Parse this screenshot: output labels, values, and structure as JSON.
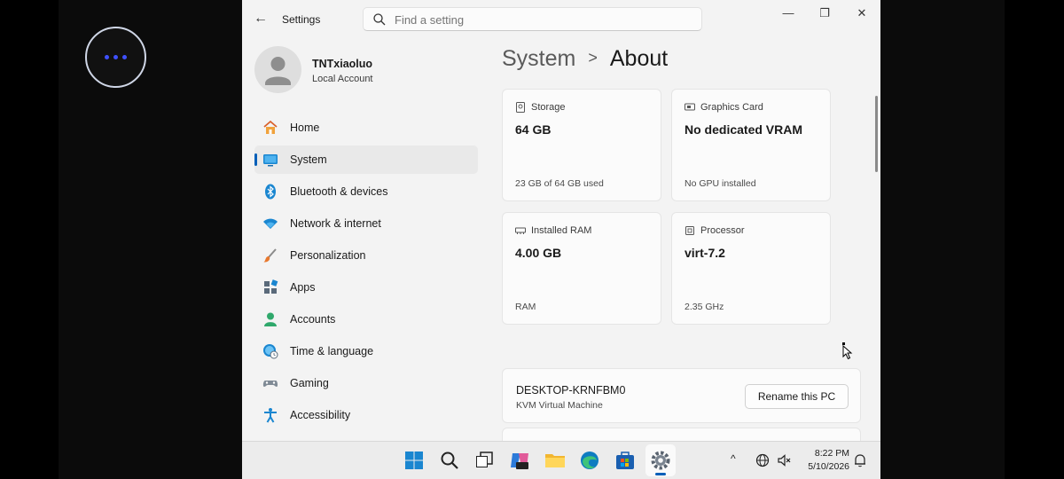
{
  "window": {
    "title": "Settings",
    "search_placeholder": "Find a setting",
    "controls": {
      "minimize": "—",
      "maximize": "❐",
      "close": "✕"
    }
  },
  "profile": {
    "name": "TNTxiaoluo",
    "account_type": "Local Account"
  },
  "nav": {
    "items": [
      {
        "label": "Home",
        "icon": "home-icon"
      },
      {
        "label": "System",
        "icon": "system-icon",
        "active": true
      },
      {
        "label": "Bluetooth & devices",
        "icon": "bluetooth-icon"
      },
      {
        "label": "Network & internet",
        "icon": "wifi-icon"
      },
      {
        "label": "Personalization",
        "icon": "brush-icon"
      },
      {
        "label": "Apps",
        "icon": "apps-icon"
      },
      {
        "label": "Accounts",
        "icon": "accounts-icon"
      },
      {
        "label": "Time & language",
        "icon": "globe-clock-icon"
      },
      {
        "label": "Gaming",
        "icon": "gamepad-icon"
      },
      {
        "label": "Accessibility",
        "icon": "accessibility-icon"
      }
    ]
  },
  "breadcrumb": {
    "parent": "System",
    "current": "About"
  },
  "specs": {
    "storage": {
      "label": "Storage",
      "value": "64 GB",
      "sub": "23 GB of 64 GB used"
    },
    "graphics": {
      "label": "Graphics Card",
      "value": "No dedicated VRAM",
      "sub": "No GPU installed"
    },
    "ram": {
      "label": "Installed RAM",
      "value": "4.00 GB",
      "sub": "RAM"
    },
    "processor": {
      "label": "Processor",
      "value": "virt-7.2",
      "sub": "2.35 GHz"
    }
  },
  "device": {
    "name": "DESKTOP-KRNFBM0",
    "model": "KVM Virtual Machine",
    "rename_label": "Rename this PC"
  },
  "taskbar": {
    "time": "8:22 PM",
    "date": "5/10/2026",
    "tray_chevron": "^"
  },
  "colors": {
    "accent": "#005fb8",
    "window_bg": "#f3f3f3",
    "card_bg": "#fbfbfb"
  }
}
